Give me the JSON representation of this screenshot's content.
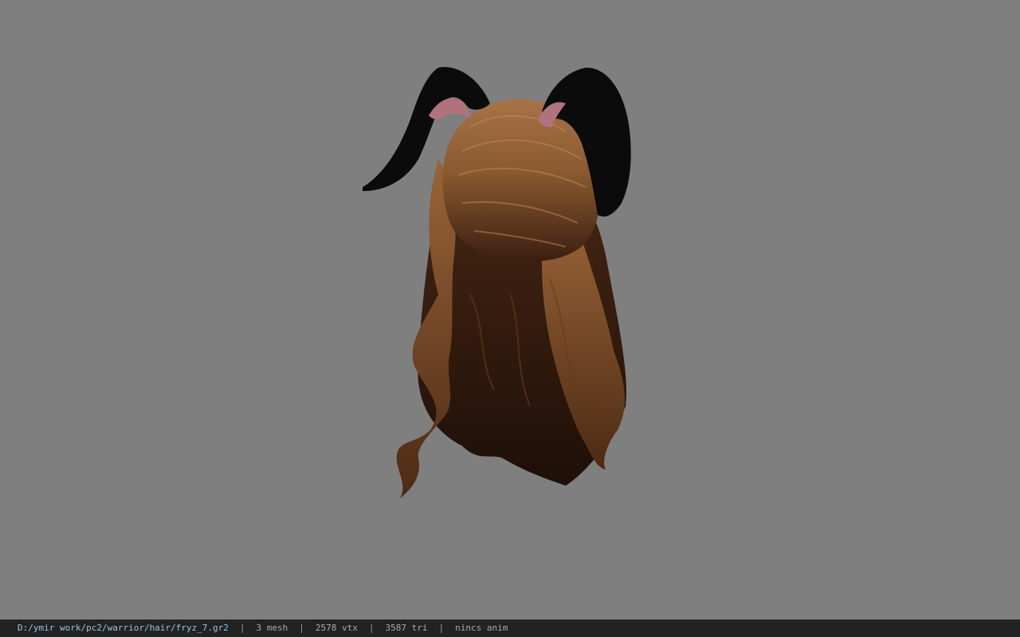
{
  "viewport": {
    "background": "#7f7f7f",
    "model": {
      "subject": "hair-model",
      "colors": {
        "ears": "#0b0b0b",
        "ear_inner": "#b0737e",
        "hair_light": "#a06a3a",
        "hair_mid": "#7a4a24",
        "hair_dark": "#2b160c"
      }
    }
  },
  "status_bar": {
    "path": "D:/ymir work/pc2/warrior/hair/fryz_7.gr2",
    "separator": "|",
    "mesh": "3 mesh",
    "vertices": "2578 vtx",
    "triangles": "3587 tri",
    "anim": "nincs anim"
  }
}
